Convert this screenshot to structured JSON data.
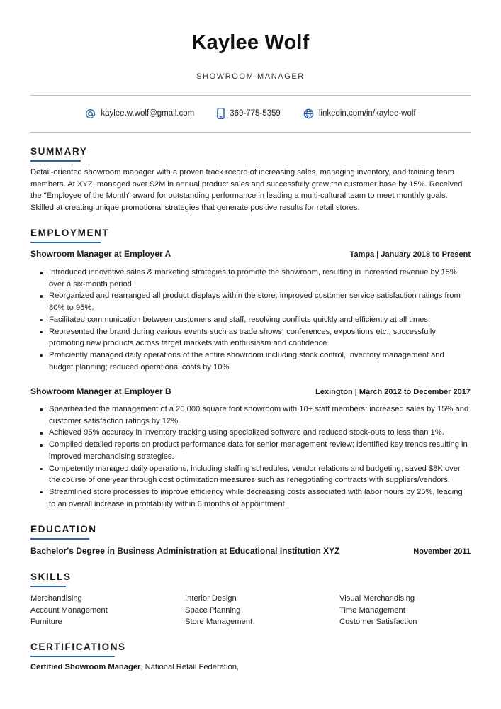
{
  "header": {
    "name": "Kaylee Wolf",
    "title": "SHOWROOM MANAGER",
    "contacts": [
      {
        "icon": "at-sign-icon",
        "value": "kaylee.w.wolf@gmail.com"
      },
      {
        "icon": "phone-icon",
        "value": "369-775-5359"
      },
      {
        "icon": "globe-icon",
        "value": "linkedin.com/in/kaylee-wolf"
      }
    ]
  },
  "colors": {
    "accent": "#2e62a8",
    "rule": "#b9b9b9",
    "text": "#222222"
  },
  "summary": {
    "heading": "SUMMARY",
    "text": "Detail-oriented showroom manager with a proven track record of increasing sales, managing inventory, and training team members. At XYZ, managed over $2M in annual product sales and successfully grew the customer base by 15%. Received the \"Employee of the Month\" award for outstanding performance in leading a multi-cultural team to meet monthly goals. Skilled at creating unique promotional strategies that generate positive results for retail stores."
  },
  "employment": {
    "heading": "EMPLOYMENT",
    "jobs": [
      {
        "title": "Showroom Manager at Employer A",
        "meta": "Tampa | January 2018 to Present",
        "bullets": [
          "Introduced innovative sales & marketing strategies to promote the showroom, resulting in increased revenue by 15% over a six-month period.",
          "Reorganized and rearranged all product displays within the store; improved customer service satisfaction ratings from 80% to 95%.",
          "Facilitated communication between customers and staff, resolving conflicts quickly and efficiently at all times.",
          "Represented the brand during various events such as trade shows, conferences, expositions etc., successfully promoting new products across target markets with enthusiasm and confidence.",
          "Proficiently managed daily operations of the entire showroom including stock control, inventory management and budget planning; reduced operational costs by 10%."
        ]
      },
      {
        "title": "Showroom Manager at Employer B",
        "meta": "Lexington | March 2012 to December 2017",
        "bullets": [
          "Spearheaded the management of a 20,000 square foot showroom with 10+ staff members; increased sales by 15% and customer satisfaction ratings by 12%.",
          "Achieved 95% accuracy in inventory tracking using specialized software and reduced stock-outs to less than 1%.",
          "Compiled detailed reports on product performance data for senior management review; identified key trends resulting in improved merchandising strategies.",
          "Competently managed daily operations, including staffing schedules, vendor relations and budgeting; saved $8K over the course of one year through cost optimization measures such as renegotiating contracts with suppliers/vendors.",
          "Streamlined store processes to improve efficiency while decreasing costs associated with labor hours by 25%, leading to an overall increase in profitability within 6 months of appointment."
        ]
      }
    ]
  },
  "education": {
    "heading": "EDUCATION",
    "degree": "Bachelor's Degree in Business Administration at Educational Institution XYZ",
    "date": "November 2011"
  },
  "skills": {
    "heading": "SKILLS",
    "items": [
      "Merchandising",
      "Interior Design",
      "Visual Merchandising",
      "Account Management",
      "Space Planning",
      "Time Management",
      "Furniture",
      "Store Management",
      "Customer Satisfaction"
    ]
  },
  "certifications": {
    "heading": "CERTIFICATIONS",
    "name": "Certified Showroom Manager",
    "issuer": ", National Retail Federation,"
  }
}
